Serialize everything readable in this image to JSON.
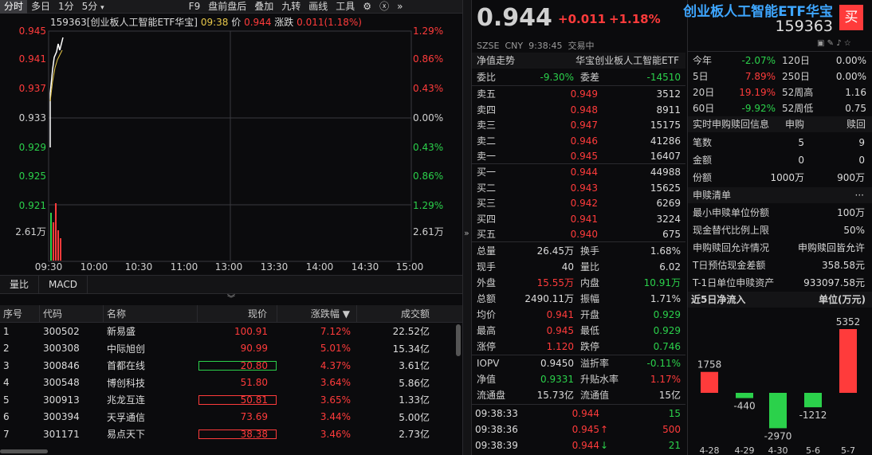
{
  "toolbar": {
    "items": [
      "分时",
      "多日",
      "1分",
      "5分",
      "F9",
      "盘前盘后",
      "叠加",
      "九转",
      "画线",
      "工具"
    ]
  },
  "chart": {
    "title_code": "159363[创业板人工智能ETF华宝]",
    "title_time": "09:38",
    "title_price_label": "价",
    "title_price": "0.944",
    "title_chg_label": "涨跌",
    "title_chg": "0.011(1.18%)",
    "price_ticks": [
      "0.945",
      "0.941",
      "0.937",
      "0.933",
      "0.929",
      "0.925",
      "0.921"
    ],
    "pct_ticks": [
      "1.29%",
      "0.86%",
      "0.43%",
      "0.00%",
      "0.43%",
      "0.86%",
      "1.29%"
    ],
    "vol_label": "2.61万",
    "time_ticks": [
      "09:30",
      "10:00",
      "10:30",
      "11:00",
      "11:30",
      "13:00",
      "13:30",
      "14:00",
      "14:30",
      "15:00"
    ]
  },
  "ind_tabs": [
    "量比",
    "MACD"
  ],
  "table": {
    "headers": [
      "序号",
      "代码",
      "名称",
      "现价",
      "涨跌幅",
      "成交额"
    ],
    "rows": [
      [
        "1",
        "300502",
        "新易盛",
        "100.91",
        "7.12%",
        "22.52亿"
      ],
      [
        "2",
        "300308",
        "中际旭创",
        "90.99",
        "5.01%",
        "15.34亿"
      ],
      [
        "3",
        "300846",
        "首都在线",
        "20.80",
        "4.37%",
        "3.61亿"
      ],
      [
        "4",
        "300548",
        "博创科技",
        "51.80",
        "3.64%",
        "5.86亿"
      ],
      [
        "5",
        "300913",
        "兆龙互连",
        "50.81",
        "3.65%",
        "1.33亿"
      ],
      [
        "6",
        "300394",
        "天孚通信",
        "73.69",
        "3.44%",
        "5.00亿"
      ],
      [
        "7",
        "301171",
        "易点天下",
        "38.38",
        "3.46%",
        "2.73亿"
      ]
    ]
  },
  "quote": {
    "price": "0.944",
    "change": "+0.011",
    "pct": "+1.18%",
    "name": "创业板人工智能ETF华宝",
    "code": "159363",
    "buy_btn": "买",
    "market": "SZSE",
    "currency": "CNY",
    "time": "9:38:45",
    "status": "交易中",
    "nav_label": "净值走势",
    "nav_name": "华宝创业板人工智能ETF",
    "wb_label": "委比",
    "wb": "-9.30%",
    "wc_label": "委差",
    "wc": "-14510",
    "asks": [
      [
        "卖五",
        "0.949",
        "3512"
      ],
      [
        "卖四",
        "0.948",
        "8911"
      ],
      [
        "卖三",
        "0.947",
        "15175"
      ],
      [
        "卖二",
        "0.946",
        "41286"
      ],
      [
        "卖一",
        "0.945",
        "16407"
      ]
    ],
    "bids": [
      [
        "买一",
        "0.944",
        "44988"
      ],
      [
        "买二",
        "0.943",
        "15625"
      ],
      [
        "买三",
        "0.942",
        "6269"
      ],
      [
        "买四",
        "0.941",
        "3224"
      ],
      [
        "买五",
        "0.940",
        "675"
      ]
    ],
    "stats": [
      [
        "总量",
        "26.45万",
        "换手",
        "1.68%"
      ],
      [
        "现手",
        "40",
        "量比",
        "6.02"
      ],
      [
        "外盘",
        "15.55万",
        "内盘",
        "10.91万"
      ],
      [
        "总额",
        "2490.11万",
        "振幅",
        "1.71%"
      ],
      [
        "均价",
        "0.941",
        "开盘",
        "0.929"
      ],
      [
        "最高",
        "0.945",
        "最低",
        "0.929"
      ],
      [
        "涨停",
        "1.120",
        "跌停",
        "0.746"
      ]
    ],
    "iopv": [
      [
        "IOPV",
        "0.9450",
        "溢折率",
        "-0.11%"
      ],
      [
        "净值",
        "0.9331",
        "升贴水率",
        "1.17%"
      ],
      [
        "流通盘",
        "15.73亿",
        "流通值",
        "15亿"
      ]
    ],
    "ticks": [
      [
        "09:38:33",
        "0.944",
        "",
        "15"
      ],
      [
        "09:38:36",
        "0.945",
        "↑",
        "500"
      ],
      [
        "09:38:39",
        "0.944",
        "↓",
        "21"
      ]
    ]
  },
  "perf": [
    [
      "今年",
      "-2.07%",
      "120日",
      "0.00%"
    ],
    [
      "5日",
      "7.89%",
      "250日",
      "0.00%"
    ],
    [
      "20日",
      "19.19%",
      "52周高",
      "1.16"
    ],
    [
      "60日",
      "-9.92%",
      "52周低",
      "0.75"
    ]
  ],
  "sg": {
    "title": "实时申购赎回信息",
    "col1": "申购",
    "col2": "赎回",
    "rows": [
      [
        "笔数",
        "5",
        "9"
      ],
      [
        "金额",
        "0",
        "0"
      ],
      [
        "份额",
        "1000万",
        "900万"
      ]
    ]
  },
  "sglist": {
    "title": "申赎清单",
    "more": "···",
    "rows": [
      [
        "最小申赎单位份额",
        "100万"
      ],
      [
        "现金替代比例上限",
        "50%"
      ],
      [
        "申购赎回允许情况",
        "申购赎回皆允许"
      ],
      [
        "T日预估现金差额",
        "358.58元"
      ],
      [
        "T-1日单位申赎资产",
        "933097.58元"
      ]
    ]
  },
  "flow": {
    "title": "近5日净流入",
    "unit": "单位(万元)",
    "values": [
      1758,
      -440,
      -2970,
      -1212,
      5352
    ],
    "labels": [
      "1758",
      "-440",
      "-2970",
      "-1212",
      "5352"
    ],
    "dates": [
      "4-28",
      "4-29",
      "4-30",
      "5-6",
      "5-7"
    ]
  },
  "colors": {
    "up": "#ff3b3b",
    "down": "#2bd14b",
    "bg": "#0b0b0d"
  }
}
